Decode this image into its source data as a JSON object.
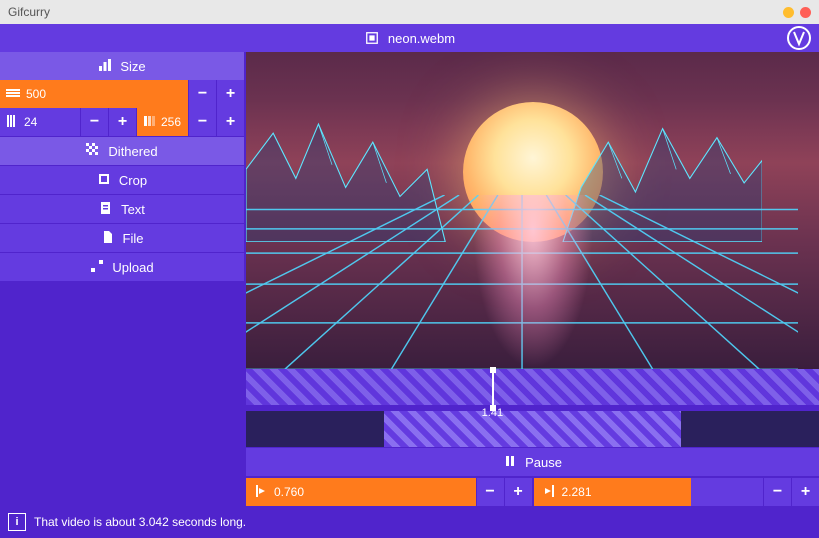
{
  "app": {
    "title": "Gifcurry"
  },
  "header": {
    "filename": "neon.webm"
  },
  "sidebar": {
    "size_label": "Size",
    "width_value": "500",
    "fps_value": "24",
    "colors_value": "256",
    "dithered_label": "Dithered",
    "crop_label": "Crop",
    "text_label": "Text",
    "file_label": "File",
    "upload_label": "Upload"
  },
  "timeline": {
    "playhead_time": "1.41",
    "pause_label": "Pause",
    "start_time": "0.760",
    "end_time": "2.281"
  },
  "status": {
    "message": "That video is about 3.042 seconds long."
  },
  "colors": {
    "accent": "#ff7b1c",
    "primary": "#643be0",
    "bg": "#5024cc"
  }
}
